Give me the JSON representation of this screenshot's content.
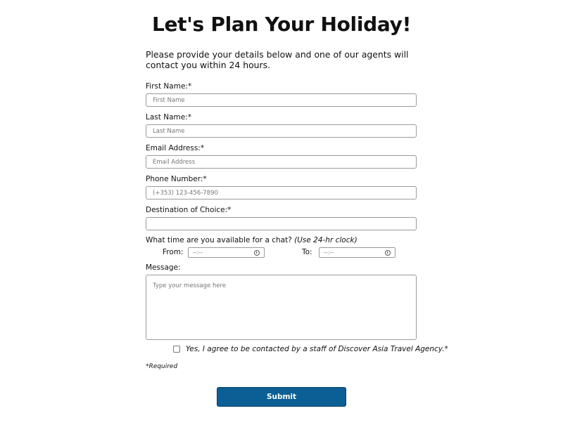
{
  "title": "Let's Plan Your Holiday!",
  "intro": "Please provide your details below and one of our agents will contact you within 24 hours.",
  "fields": {
    "first_name": {
      "label": "First Name:*",
      "placeholder": "First Name"
    },
    "last_name": {
      "label": "Last Name:*",
      "placeholder": "Last Name"
    },
    "email": {
      "label": "Email Address:*",
      "placeholder": "Email Address"
    },
    "phone": {
      "label": "Phone Number:*",
      "placeholder": "(+353) 123-456-7890"
    },
    "destination": {
      "label": "Destination of Choice:*",
      "placeholder": ""
    }
  },
  "availability": {
    "question": "What time are you available for a chat?",
    "hint": "(Use 24-hr clock)",
    "from_label": "From:",
    "to_label": "To:",
    "from_placeholder": "--:--",
    "to_placeholder": "--:--"
  },
  "message": {
    "label": "Message:",
    "placeholder": "Type your message here"
  },
  "consent": "Yes, I agree to be contacted by a staff of Discover Asia Travel Agency.*",
  "required_note": "*Required",
  "submit_label": "Submit",
  "colors": {
    "submit_bg": "#0b5f95",
    "input_border": "#9a9a9a"
  }
}
